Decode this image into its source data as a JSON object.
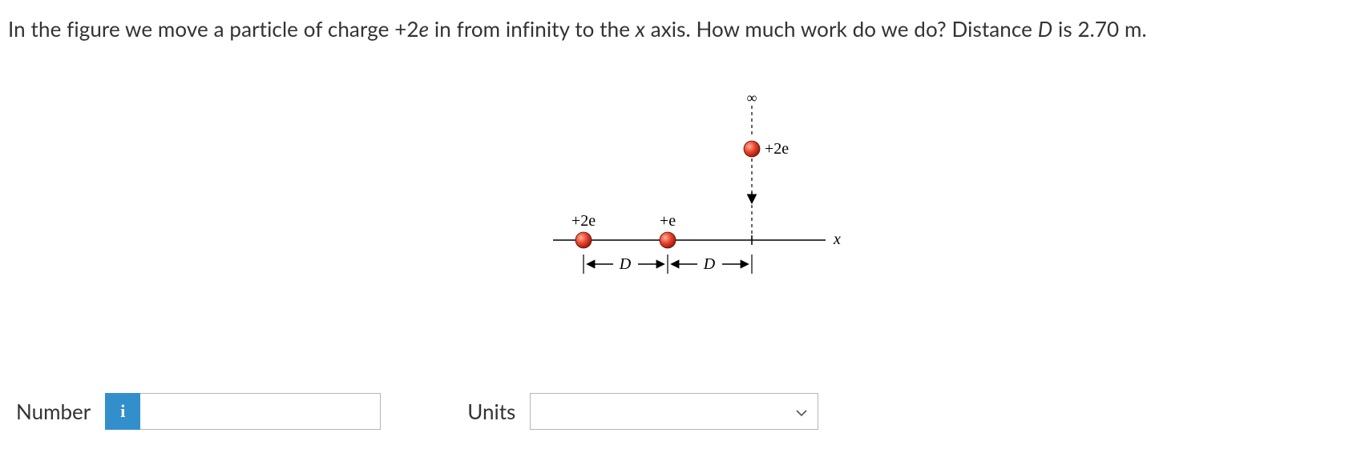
{
  "question": {
    "full_text": "In the figure we move a particle of charge +2e in from infinity to the x axis. How much work do we do? Distance D is 2.70 m."
  },
  "diagram": {
    "infinity_symbol": "∞",
    "moving_charge_label": "+2e",
    "left_charge_label": "+2e",
    "mid_charge_label": "+e",
    "axis_label": "x",
    "distance_label_left": "D",
    "distance_label_right": "D"
  },
  "answer": {
    "number_label": "Number",
    "number_value": "",
    "units_label": "Units",
    "units_value": "",
    "info_icon_text": "i"
  }
}
